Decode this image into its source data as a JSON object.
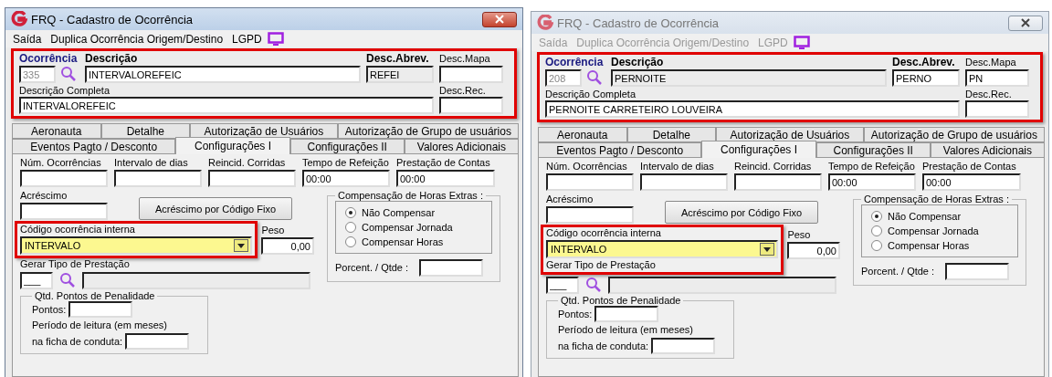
{
  "windows": [
    {
      "title": "FRQ - Cadastro de Ocorrência",
      "active": true,
      "menu": [
        "Saída",
        "Duplica Ocorrência Origem/Destino",
        "LGPD"
      ],
      "header": {
        "highlighted": true,
        "ocorrencia": {
          "label": "Ocorrência",
          "value": "335",
          "disabled": true
        },
        "descricao": {
          "label": "Descrição",
          "value": "INTERVALOREFEIC",
          "readonly": false
        },
        "desc_abrev": {
          "label": "Desc.Abrev.",
          "value": "REFEI",
          "readonly": true
        },
        "desc_mapa": {
          "label": "Desc.Mapa"
        },
        "descricao_completa": {
          "label": "Descrição Completa",
          "value": "INTERVALOREFEIC"
        },
        "desc_rec": {
          "label": "Desc.Rec."
        }
      },
      "tabs_row1": [
        {
          "label": "Aeronauta",
          "selected": false
        },
        {
          "label": "Detalhe",
          "selected": false
        },
        {
          "label": "Autorização de Usuários",
          "selected": false
        },
        {
          "label": "Autorização de Grupo de usuários",
          "selected": false
        }
      ],
      "tabs_row2": [
        {
          "label": "Eventos Pagto / Desconto",
          "selected": false
        },
        {
          "label": "Configurações I",
          "selected": true
        },
        {
          "label": "Configurações II",
          "selected": false
        },
        {
          "label": "Valores Adicionais",
          "selected": false
        }
      ],
      "panel": {
        "top_fields": [
          {
            "label": "Núm. Ocorrências"
          },
          {
            "label": "Intervalo de dias"
          },
          {
            "label": "Reincid. Corridas"
          },
          {
            "label": "Tempo de Refeição",
            "value": "00:00"
          },
          {
            "label": "Prestação de Contas",
            "value": "00:00"
          }
        ],
        "acrescimo": {
          "label": "Acréscimo"
        },
        "fixed_code_button": "Acréscimo por Código Fixo",
        "compensation": {
          "title": "Compensação de Horas Extras :",
          "options": [
            {
              "label": "Não Compensar",
              "selected": true
            },
            {
              "label": "Compensar Jornada",
              "selected": false
            },
            {
              "label": "Compensar Horas",
              "selected": false
            }
          ],
          "percent_label": "Porcent. / Qtde :"
        },
        "internal_code": {
          "label": "Código ocorrência interna",
          "value": "INTERVALO",
          "highlighted": true,
          "highlight_includes_next_label": false
        },
        "peso": {
          "label": "Peso",
          "value": "0,00"
        },
        "prestacao": {
          "label": "Gerar Tipo de Prestação",
          "code": "___"
        },
        "penalty": {
          "title": "Qtd. Pontos de Penalidade",
          "points_label": "Pontos:",
          "period_label": "Período de leitura (em meses)",
          "conduct_label": "na ficha de conduta:"
        }
      }
    },
    {
      "title": "FRQ - Cadastro de Ocorrência",
      "active": false,
      "menu": [
        "Saída",
        "Duplica Ocorrência Origem/Destino",
        "LGPD"
      ],
      "header": {
        "highlighted": true,
        "ocorrencia": {
          "label": "Ocorrência",
          "value": "208",
          "disabled": true
        },
        "descricao": {
          "label": "Descrição",
          "value": "PERNOITE",
          "readonly": true
        },
        "desc_abrev": {
          "label": "Desc.Abrev.",
          "value": "PERNO",
          "readonly": false
        },
        "desc_mapa": {
          "label": "Desc.Mapa",
          "value": "PN"
        },
        "descricao_completa": {
          "label": "Descrição Completa",
          "value": "PERNOITE CARRETEIRO LOUVEIRA"
        },
        "desc_rec": {
          "label": "Desc.Rec."
        }
      },
      "tabs_row1": [
        {
          "label": "Aeronauta",
          "selected": false
        },
        {
          "label": "Detalhe",
          "selected": false
        },
        {
          "label": "Autorização de Usuários",
          "selected": false
        },
        {
          "label": "Autorização de Grupo de usuários",
          "selected": false
        }
      ],
      "tabs_row2": [
        {
          "label": "Eventos Pagto / Desconto",
          "selected": false
        },
        {
          "label": "Configurações I",
          "selected": true
        },
        {
          "label": "Configurações II",
          "selected": false
        },
        {
          "label": "Valores Adicionais",
          "selected": false
        }
      ],
      "panel": {
        "top_fields": [
          {
            "label": "Núm. Ocorrências"
          },
          {
            "label": "Intervalo de dias"
          },
          {
            "label": "Reincid. Corridas"
          },
          {
            "label": "Tempo de Refeição",
            "value": "00:00"
          },
          {
            "label": "Prestação de Contas",
            "value": "00:00"
          }
        ],
        "acrescimo": {
          "label": "Acréscimo"
        },
        "fixed_code_button": "Acréscimo por Código Fixo",
        "compensation": {
          "title": "Compensação de Horas Extras :",
          "options": [
            {
              "label": "Não Compensar",
              "selected": true
            },
            {
              "label": "Compensar Jornada",
              "selected": false
            },
            {
              "label": "Compensar Horas",
              "selected": false
            }
          ],
          "percent_label": "Porcent. / Qtde :"
        },
        "internal_code": {
          "label": "Código ocorrência interna",
          "value": "INTERVALO",
          "highlighted": true,
          "highlight_includes_next_label": true
        },
        "peso": {
          "label": "Peso",
          "value": "0,00"
        },
        "prestacao": {
          "label": "Gerar Tipo de Prestação",
          "code": "___"
        },
        "penalty": {
          "title": "Qtd. Pontos de Penalidade",
          "points_label": "Pontos:",
          "period_label": "Período de leitura (em meses)",
          "conduct_label": "na ficha de conduta:"
        }
      }
    }
  ]
}
